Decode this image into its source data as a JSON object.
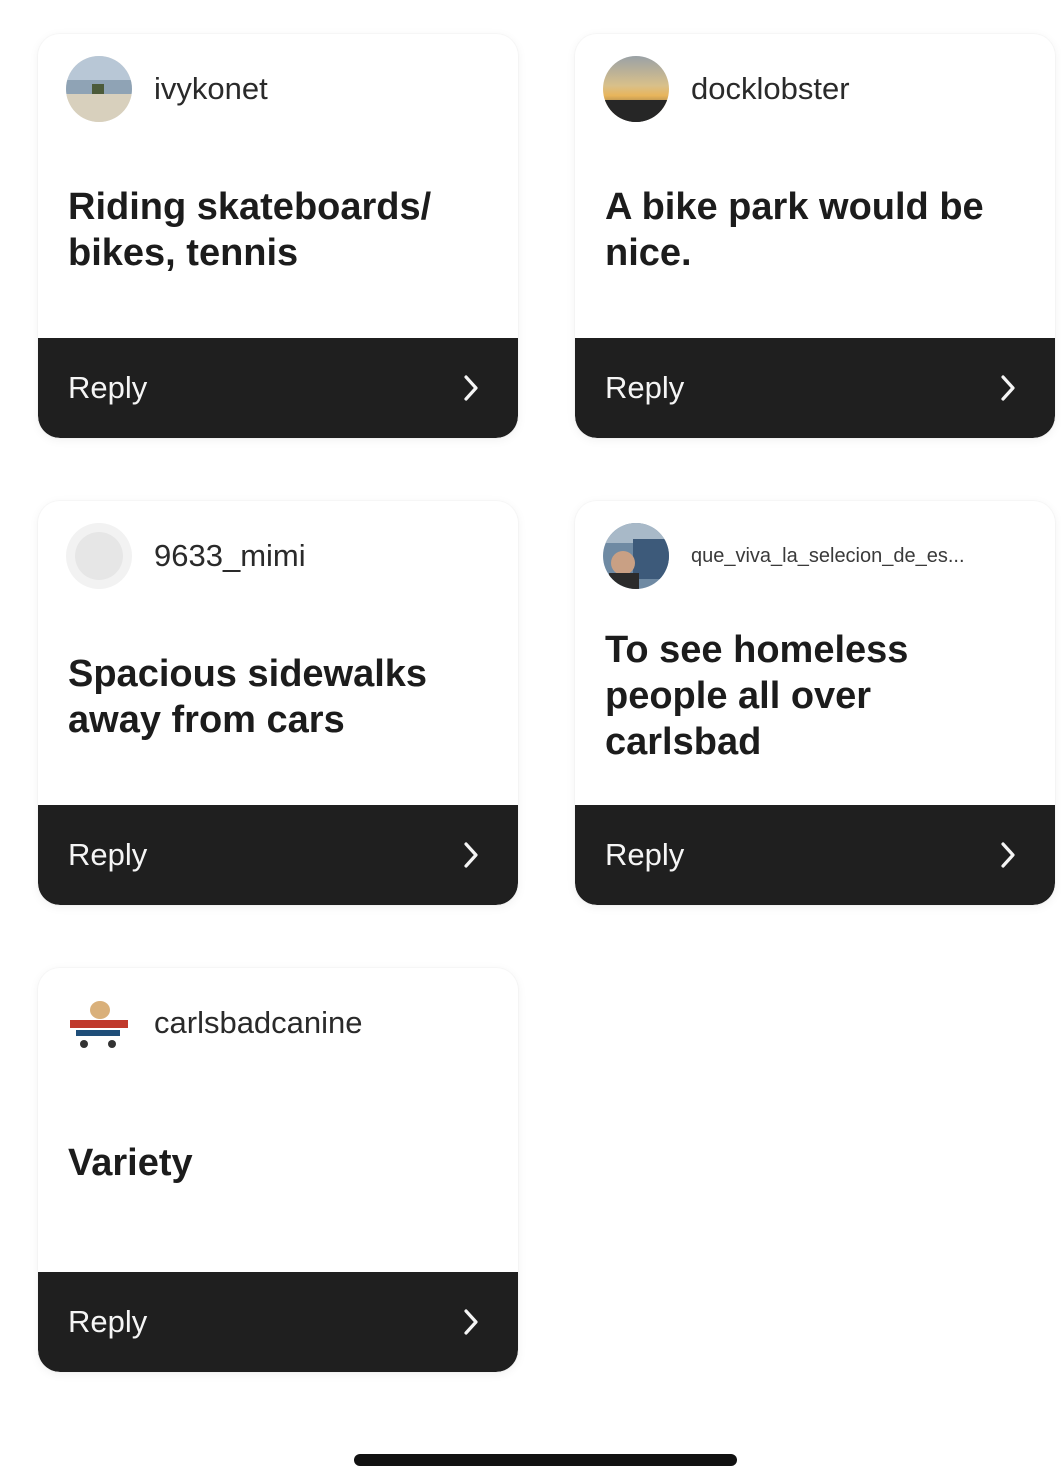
{
  "colors": {
    "reply_bar": "#1f1f1f",
    "reply_text": "#f5f5f5",
    "body_text": "#1c1c1c",
    "card_bg": "#ffffff"
  },
  "cards": [
    {
      "username": "ivykonet",
      "text": "Riding skateboards/ bikes, tennis",
      "reply_label": "Reply",
      "avatar_icon": "beach-photo-avatar"
    },
    {
      "username": "docklobster",
      "text": "A bike park would be nice.",
      "reply_label": "Reply",
      "avatar_icon": "sunset-photo-avatar"
    },
    {
      "username": "9633_mimi",
      "text": "Spacious sidewalks away from cars",
      "reply_label": "Reply",
      "avatar_icon": "default-avatar"
    },
    {
      "username": "que_viva_la_selecion_de_es...",
      "text": "To see homeless people all over carlsbad",
      "reply_label": "Reply",
      "avatar_icon": "person-photo-avatar"
    },
    {
      "username": "carlsbadcanine",
      "text": "Variety",
      "reply_label": "Reply",
      "avatar_icon": "dog-logo-avatar"
    }
  ]
}
